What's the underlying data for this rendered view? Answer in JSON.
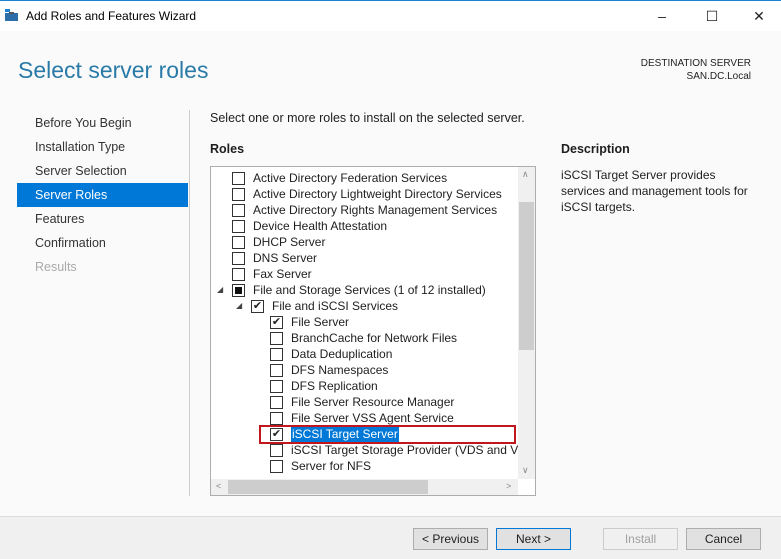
{
  "window": {
    "title": "Add Roles and Features Wizard",
    "minimize": "–",
    "maximize": "☐",
    "close": "✕"
  },
  "header": {
    "page_title": "Select server roles",
    "dest_label": "DESTINATION SERVER",
    "dest_server": "SAN.DC.Local"
  },
  "nav": {
    "items": [
      {
        "label": "Before You Begin",
        "state": "normal"
      },
      {
        "label": "Installation Type",
        "state": "normal"
      },
      {
        "label": "Server Selection",
        "state": "normal"
      },
      {
        "label": "Server Roles",
        "state": "selected"
      },
      {
        "label": "Features",
        "state": "normal"
      },
      {
        "label": "Confirmation",
        "state": "normal"
      },
      {
        "label": "Results",
        "state": "disabled"
      }
    ]
  },
  "main": {
    "intro": "Select one or more roles to install on the selected server.",
    "roles_heading": "Roles",
    "roles": [
      {
        "label": "Active Directory Federation Services",
        "level": 0,
        "state": "unchecked"
      },
      {
        "label": "Active Directory Lightweight Directory Services",
        "level": 0,
        "state": "unchecked"
      },
      {
        "label": "Active Directory Rights Management Services",
        "level": 0,
        "state": "unchecked"
      },
      {
        "label": "Device Health Attestation",
        "level": 0,
        "state": "unchecked"
      },
      {
        "label": "DHCP Server",
        "level": 0,
        "state": "unchecked"
      },
      {
        "label": "DNS Server",
        "level": 0,
        "state": "unchecked"
      },
      {
        "label": "Fax Server",
        "level": 0,
        "state": "unchecked"
      },
      {
        "label": "File and Storage Services (1 of 12 installed)",
        "level": 0,
        "state": "partial",
        "expanded": true
      },
      {
        "label": "File and iSCSI Services",
        "level": 1,
        "state": "checked",
        "expanded": true
      },
      {
        "label": "File Server",
        "level": 2,
        "state": "checked"
      },
      {
        "label": "BranchCache for Network Files",
        "level": 2,
        "state": "unchecked"
      },
      {
        "label": "Data Deduplication",
        "level": 2,
        "state": "unchecked"
      },
      {
        "label": "DFS Namespaces",
        "level": 2,
        "state": "unchecked"
      },
      {
        "label": "DFS Replication",
        "level": 2,
        "state": "unchecked"
      },
      {
        "label": "File Server Resource Manager",
        "level": 2,
        "state": "unchecked"
      },
      {
        "label": "File Server VSS Agent Service",
        "level": 2,
        "state": "unchecked"
      },
      {
        "label": "iSCSI Target Server",
        "level": 2,
        "state": "checked",
        "selected": true
      },
      {
        "label": "iSCSI Target Storage Provider (VDS and VSS hardware providers)",
        "level": 2,
        "state": "unchecked"
      },
      {
        "label": "Server for NFS",
        "level": 2,
        "state": "unchecked"
      }
    ],
    "description_heading": "Description",
    "description": "iSCSI Target Server provides services and management tools for iSCSI targets."
  },
  "footer": {
    "previous": "< Previous",
    "next": "Next >",
    "install": "Install",
    "cancel": "Cancel"
  },
  "colors": {
    "accent": "#0078d7",
    "title": "#2a7aa8",
    "highlight_box": "#c0161c"
  }
}
